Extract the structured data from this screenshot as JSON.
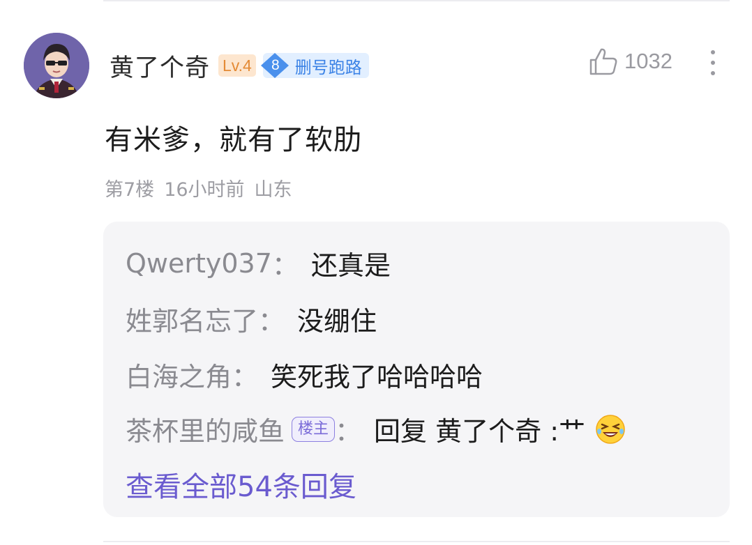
{
  "comment": {
    "username": "黄了个奇",
    "level": "Lv.4",
    "fan_level": "8",
    "fan_title": "删号跑路",
    "likes": "1032",
    "text": "有米爹，就有了软肋",
    "floor": "第7楼",
    "time": "16小时前",
    "location": "山东"
  },
  "replies": [
    {
      "name": "Qwerty037",
      "sep": "：",
      "content": "还真是"
    },
    {
      "name": "姓郭名忘了",
      "sep": "：",
      "content": "没绷住"
    },
    {
      "name": "白海之角",
      "sep": "：",
      "content": "笑死我了哈哈哈哈"
    },
    {
      "name": "茶杯里的咸鱼",
      "badge": "楼主",
      "sep": "：",
      "content": "回复 黄了个奇 :艹",
      "emoji": "laughing-emoji"
    }
  ],
  "view_all": "查看全部54条回复",
  "colors": {
    "accent": "#6a5bcf",
    "level_badge_bg": "#fde6cf",
    "level_badge_text": "#e48a35",
    "fan_badge_bg": "#e2efff",
    "fan_badge_text": "#3c83e6"
  }
}
